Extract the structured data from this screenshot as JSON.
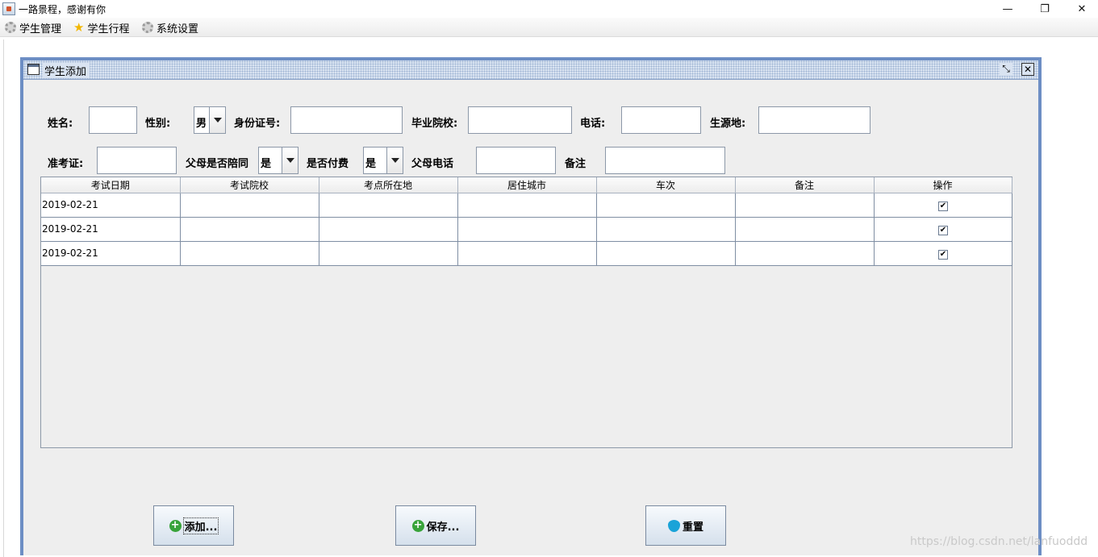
{
  "window": {
    "title": "一路景程，感谢有你",
    "controls": {
      "minimize": "—",
      "maximize": "❐",
      "close": "✕"
    }
  },
  "menu": {
    "items": [
      {
        "label": "学生管理",
        "icon": "gear-icon"
      },
      {
        "label": "学生行程",
        "icon": "star-icon"
      },
      {
        "label": "系统设置",
        "icon": "gear-icon"
      }
    ]
  },
  "frame": {
    "title": "学生添加",
    "restore_glyph": "⤡",
    "close_glyph": "✕"
  },
  "form": {
    "name_label": "姓名:",
    "gender_label": "性别:",
    "gender_value": "男",
    "idcard_label": "身份证号:",
    "school_label": "毕业院校:",
    "phone_label": "电话:",
    "origin_label": "生源地:",
    "ticket_label": "准考证:",
    "parent_accompany_label": "父母是否陪同",
    "parent_accompany_value": "是",
    "paid_label": "是否付费",
    "paid_value": "是",
    "parent_phone_label": "父母电话",
    "remark_label": "备注"
  },
  "table": {
    "headers": [
      "考试日期",
      "考试院校",
      "考点所在地",
      "居住城市",
      "车次",
      "备注",
      "操作"
    ],
    "rows": [
      {
        "date": "2019-02-21",
        "school": "",
        "location": "",
        "city": "",
        "train": "",
        "remark": "",
        "checked": "✔"
      },
      {
        "date": "2019-02-21",
        "school": "",
        "location": "",
        "city": "",
        "train": "",
        "remark": "",
        "checked": "✔"
      },
      {
        "date": "2019-02-21",
        "school": "",
        "location": "",
        "city": "",
        "train": "",
        "remark": "",
        "checked": "✔"
      }
    ]
  },
  "buttons": {
    "add": "添加...",
    "save": "保存...",
    "reset": "重置",
    "plus_glyph": "+"
  },
  "watermark": "https://blog.csdn.net/lanfuoddd",
  "colors": {
    "frame_border": "#6d8ec4",
    "panel_bg": "#eeeeee",
    "add_icon": "#38a33a",
    "reset_icon": "#1aa3d8"
  }
}
